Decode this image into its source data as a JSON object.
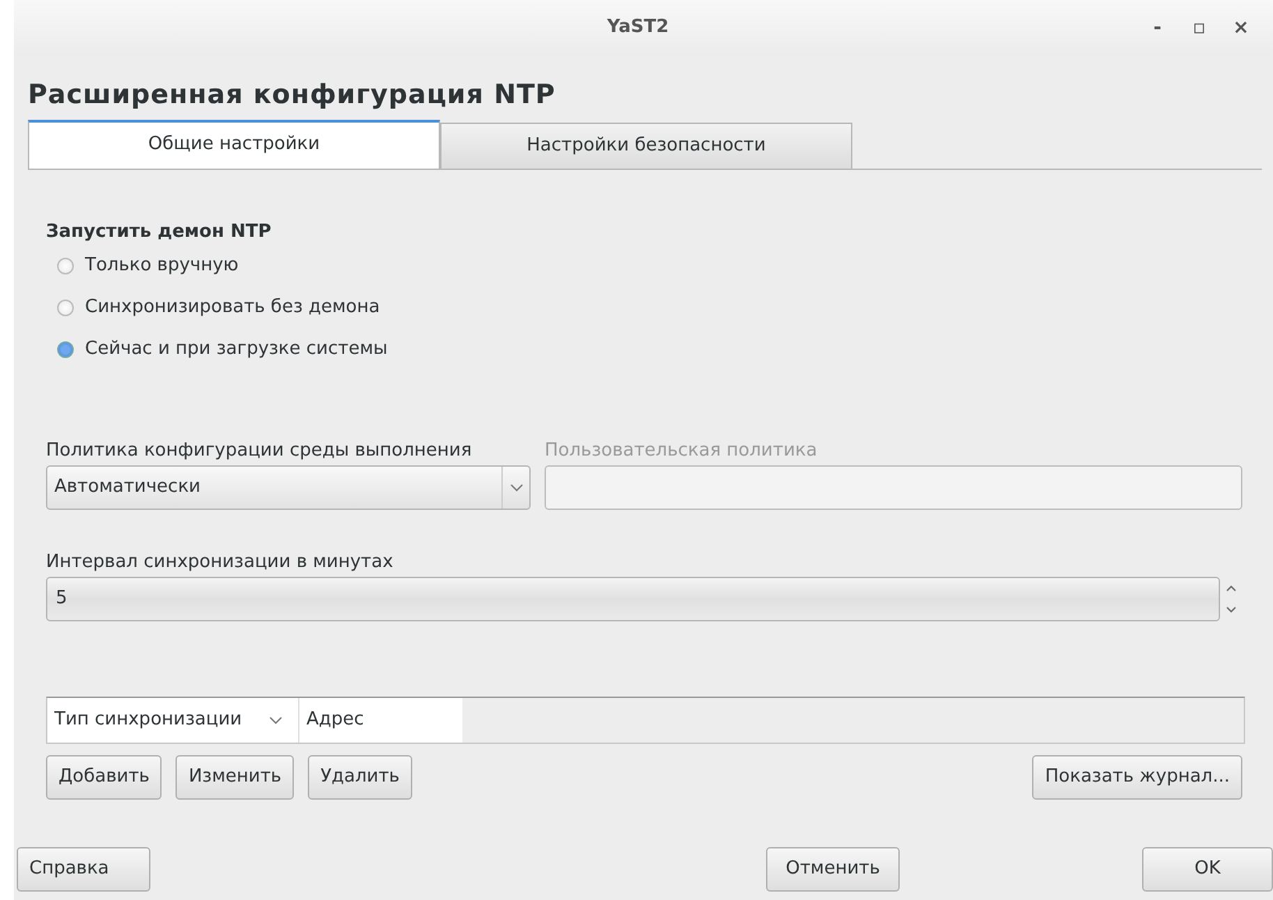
{
  "window": {
    "title": "YaST2",
    "controls": [
      "-",
      "▫",
      "×"
    ]
  },
  "heading": "Расширенная конфигурация NTP",
  "tabs": [
    {
      "label": "Общие настройки",
      "selected": true
    },
    {
      "label": "Настройки безопасности",
      "selected": false
    }
  ],
  "daemon": {
    "label": "Запустить демон NTP",
    "options": [
      {
        "label": "Только вручную",
        "selected": false
      },
      {
        "label": "Синхронизировать без демона",
        "selected": false
      },
      {
        "label": "Сейчас и при загрузке системы",
        "selected": true
      }
    ]
  },
  "policy": {
    "label": "Политика конфигурации среды выполнения",
    "value": "Автоматически"
  },
  "custom_policy": {
    "label": "Пользовательская политика",
    "disabled": true
  },
  "interval": {
    "label": "Интервал синхронизации в минутах",
    "value": "5"
  },
  "table": {
    "columns": [
      "Тип синхронизации",
      "Адрес"
    ]
  },
  "table_buttons": [
    "Добавить",
    "Изменить",
    "Удалить"
  ],
  "log_button": "Показать журнал...",
  "footer": {
    "help": "Справка",
    "cancel": "Отменить",
    "ok": "OK"
  }
}
